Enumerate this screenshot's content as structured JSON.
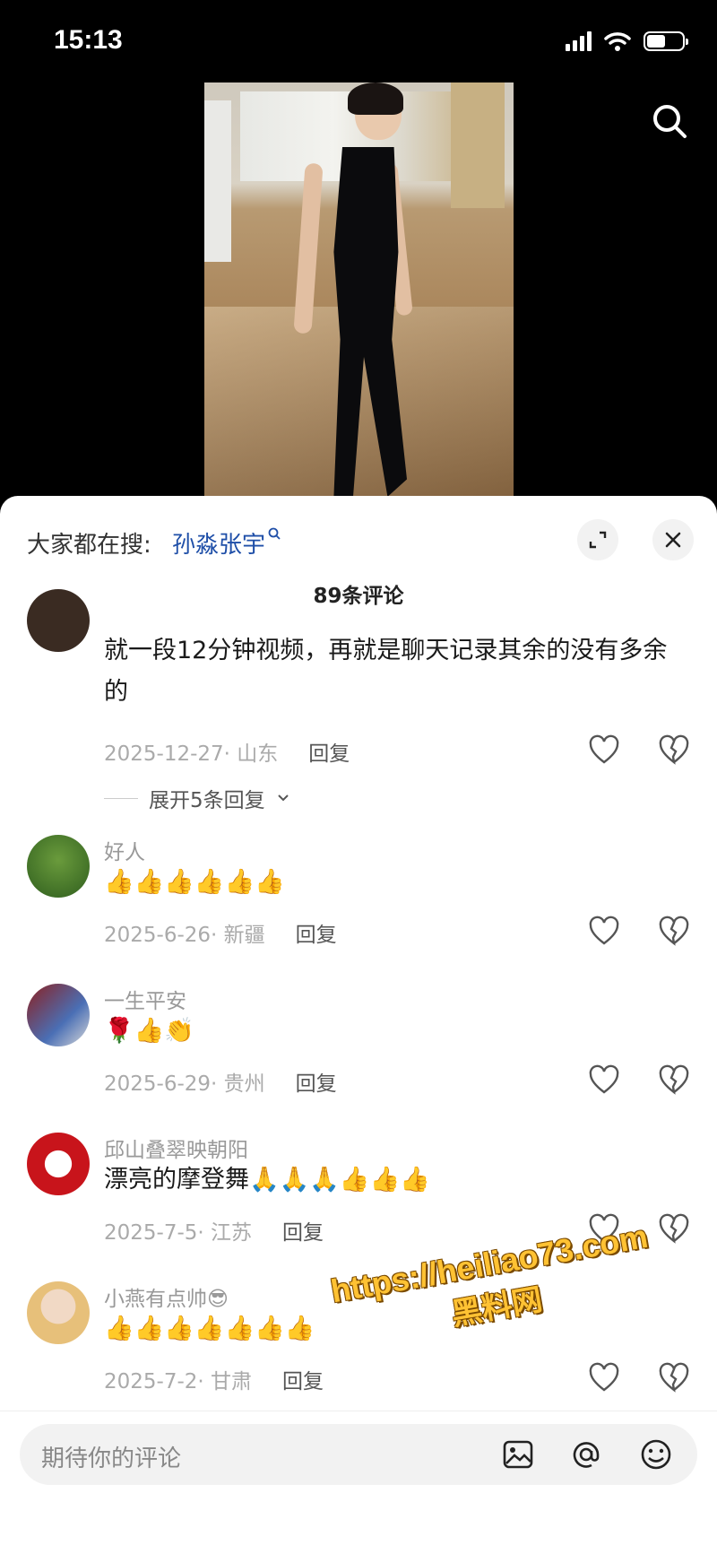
{
  "status_bar": {
    "time": "15:13"
  },
  "sheet": {
    "hot_search_prefix": "大家都在搜:",
    "hot_search_term": "孙淼张宇",
    "comment_count": "89条评论"
  },
  "comments": [
    {
      "text": "就一段12分钟视频，再就是聊天记录其余的没有多余的",
      "date": "2025-12-27",
      "location": "山东",
      "reply_label": "回复",
      "expand_replies": "展开5条回复"
    },
    {
      "user": "好人",
      "emoji": "👍👍👍👍👍👍",
      "date": "2025-6-26",
      "location": "新疆",
      "reply_label": "回复"
    },
    {
      "user": "一生平安",
      "emoji": "🌹👍👏",
      "date": "2025-6-29",
      "location": "贵州",
      "reply_label": "回复"
    },
    {
      "user": "邱山叠翠映朝阳",
      "text": "漂亮的摩登舞",
      "emoji": "🙏🙏🙏👍👍👍",
      "date": "2025-7-5",
      "location": "江苏",
      "reply_label": "回复"
    },
    {
      "user": "小燕有点帅😎",
      "emoji": "👍👍👍👍👍👍👍",
      "date": "2025-7-2",
      "location": "甘肃",
      "reply_label": "回复"
    }
  ],
  "watermark": {
    "line1": "https://heiliao73.com",
    "line2": "黑料网"
  },
  "input": {
    "placeholder": "期待你的评论"
  },
  "colors": {
    "link": "#1f4fa8",
    "watermark": "#ffc233",
    "sheet_bg": "#ffffff"
  }
}
